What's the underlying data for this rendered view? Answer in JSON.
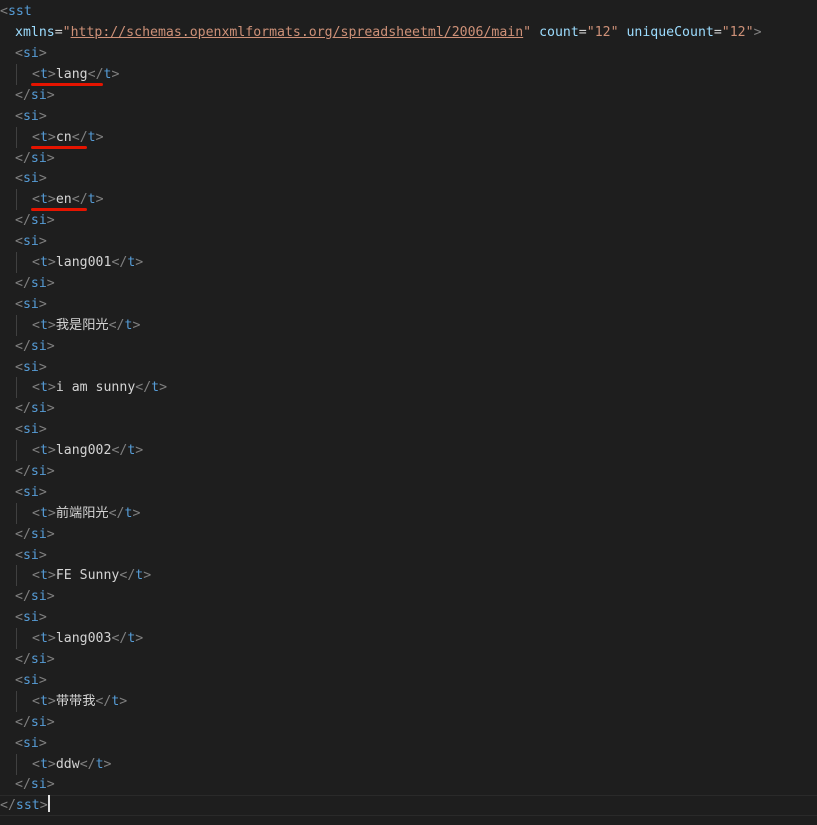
{
  "root": {
    "open_tag": "sst",
    "close_tag": "sst",
    "attributes": [
      {
        "name": "xmlns",
        "value": "http://schemas.openxmlformats.org/spreadsheetml/2006/main"
      },
      {
        "name": "count",
        "value": "12"
      },
      {
        "name": "uniqueCount",
        "value": "12"
      }
    ]
  },
  "item_tag": "si",
  "text_tag": "t",
  "items": [
    "lang",
    "cn",
    "en",
    "lang001",
    "我是阳光",
    "i am sunny",
    "lang002",
    "前端阳光",
    "FE Sunny",
    "lang003",
    "带带我",
    "ddw"
  ],
  "annotations": {
    "color": "#e51400",
    "underlined_items": [
      "lang",
      "cn",
      "en"
    ]
  },
  "theme": {
    "background": "#1e1e1e",
    "tag_color": "#569cd6",
    "attr_color": "#9cdcfe",
    "string_color": "#ce9178",
    "text_color": "#d4d4d4",
    "bracket_color": "#808080"
  }
}
